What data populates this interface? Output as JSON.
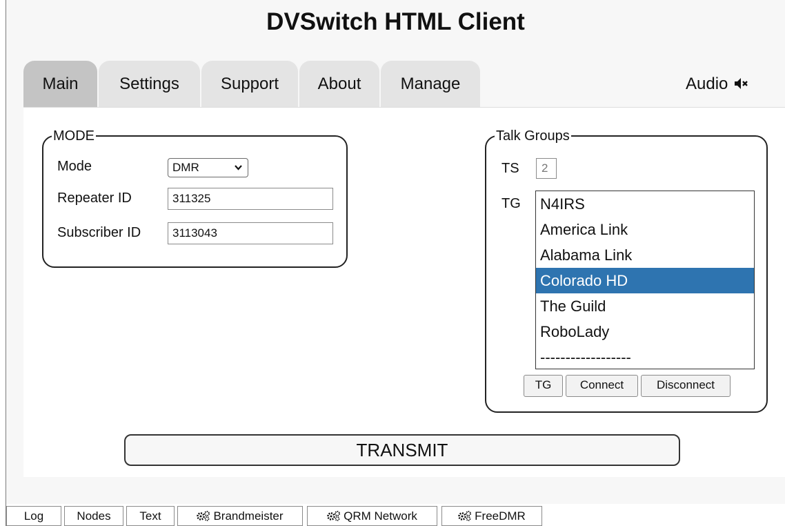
{
  "app": {
    "title": "DVSwitch HTML Client"
  },
  "tabs": [
    {
      "label": "Main",
      "active": true
    },
    {
      "label": "Settings"
    },
    {
      "label": "Support"
    },
    {
      "label": "About"
    },
    {
      "label": "Manage"
    }
  ],
  "audio": {
    "label": "Audio",
    "icon": "speaker-muted-icon"
  },
  "mode_panel": {
    "legend": "MODE",
    "mode_label": "Mode",
    "mode_value": "DMR",
    "repeater_label": "Repeater ID",
    "repeater_value": "311325",
    "subscriber_label": "Subscriber ID",
    "subscriber_value": "3113043"
  },
  "talkgroups": {
    "legend": "Talk Groups",
    "ts_label": "TS",
    "ts_value": "2",
    "tg_label": "TG",
    "options": [
      "N4IRS",
      "America Link",
      "Alabama Link",
      "Colorado HD",
      "The Guild",
      "RoboLady",
      "------------------"
    ],
    "selected": "Colorado HD",
    "buttons": {
      "tg": "TG",
      "connect": "Connect",
      "disconnect": "Disconnect"
    }
  },
  "transmit": {
    "label": "TRANSMIT"
  },
  "bottom_tabs": [
    {
      "label": "Log"
    },
    {
      "label": "Nodes"
    },
    {
      "label": "Text"
    },
    {
      "label": "Brandmeister",
      "icon": "gears-icon"
    },
    {
      "label": "QRM Network",
      "icon": "gears-icon"
    },
    {
      "label": "FreeDMR",
      "icon": "gears-icon"
    }
  ],
  "colors": {
    "selected_option": "#2e74b0",
    "active_tab": "#c4c4c4",
    "inactive_tab": "#e4e4e4"
  }
}
